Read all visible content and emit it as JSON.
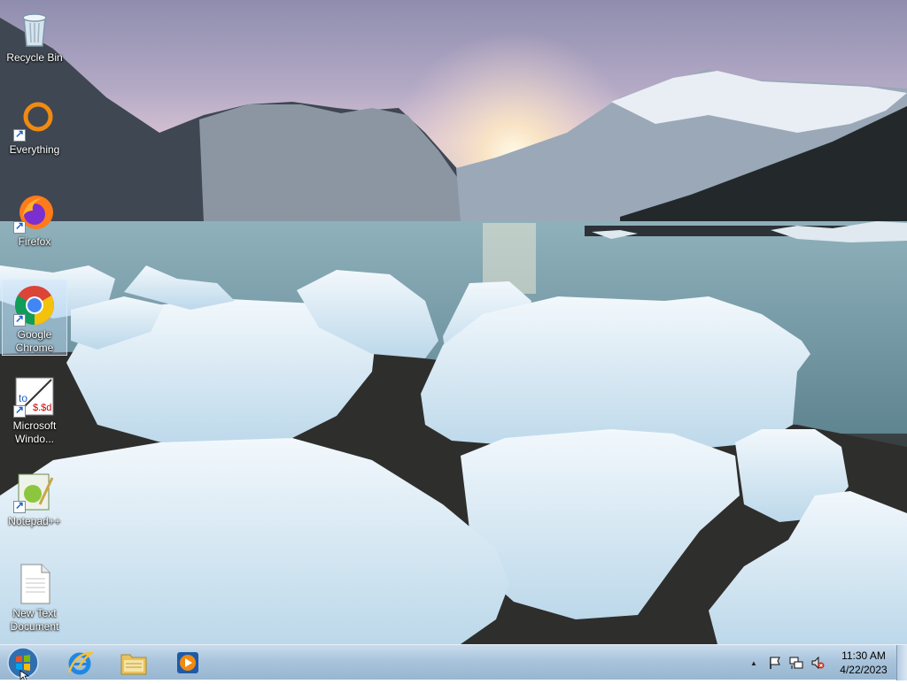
{
  "desktop": {
    "icons": [
      {
        "label": "Recycle Bin"
      },
      {
        "label": "Everything"
      },
      {
        "label": "Firefox"
      },
      {
        "label": "Google Chrome"
      },
      {
        "label": "Microsoft Windo..."
      },
      {
        "label": "Notepad++"
      },
      {
        "label": "New Text Document"
      }
    ]
  },
  "taskbar": {
    "start_icon": "windows-start-orb",
    "pinned": [
      {
        "name": "internet-explorer-icon"
      },
      {
        "name": "file-explorer-icon"
      },
      {
        "name": "media-player-icon"
      }
    ],
    "tray": {
      "icons": [
        "show-hidden-icons-chevron",
        "action-center-flag-icon",
        "network-icon",
        "volume-muted-icon"
      ],
      "chevron": "▲",
      "time": "11:30 AM",
      "date": "4/22/2023"
    }
  }
}
